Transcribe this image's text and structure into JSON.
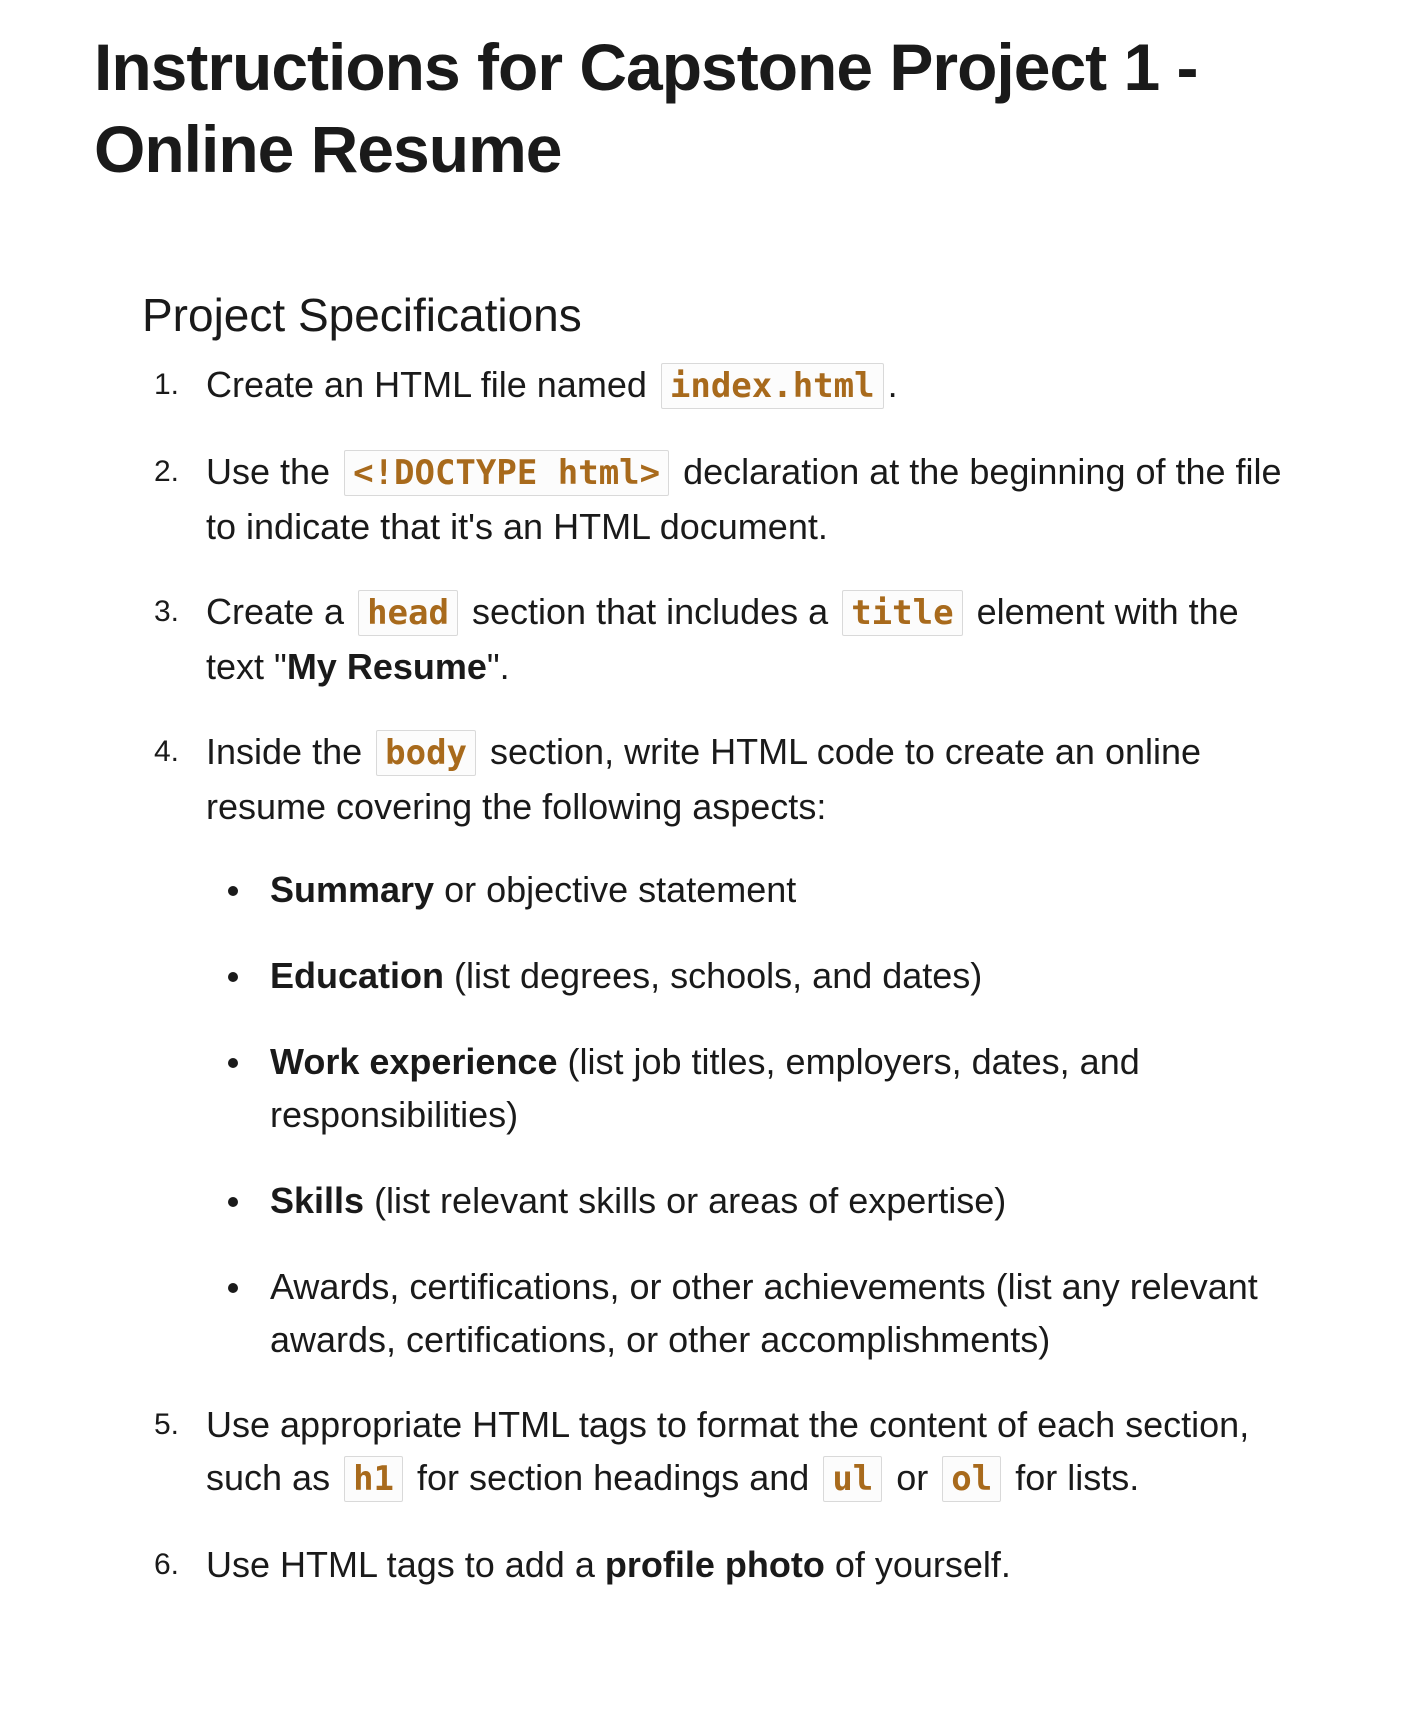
{
  "title": "Instructions for Capstone Project 1 - Online Resume",
  "section_heading": "Project Specifications",
  "steps": [
    {
      "number": "1.",
      "parts": [
        "Create an HTML file named ",
        "index.html",
        "."
      ]
    },
    {
      "number": "2.",
      "parts": [
        "Use the ",
        "<!DOCTYPE html>",
        " declaration at the beginning of the file to indicate that it's an HTML document."
      ]
    },
    {
      "number": "3.",
      "parts": [
        "Create a ",
        "head",
        " section that includes a ",
        "title",
        " element with the text \"",
        "My Resume",
        "\"."
      ]
    },
    {
      "number": "4.",
      "parts": [
        "Inside the ",
        "body",
        " section, write HTML code to create an online resume covering the following aspects:"
      ],
      "aspects": [
        {
          "bold": "Summary",
          "text": " or objective statement"
        },
        {
          "bold": "Education",
          "text": " (list degrees, schools, and dates)"
        },
        {
          "bold": "Work experience",
          "text": " (list job titles, employers, dates, and responsibilities)"
        },
        {
          "bold": "Skills",
          "text": " (list relevant skills or areas of expertise)"
        },
        {
          "bold": "",
          "text": "Awards, certifications, or other achievements (list any relevant awards, certifications, or other accomplishments)"
        }
      ]
    },
    {
      "number": "5.",
      "parts": [
        "Use appropriate HTML tags to format the content of each section, such as ",
        "h1",
        " for section headings and ",
        "ul",
        " or ",
        "ol",
        " for lists."
      ]
    },
    {
      "number": "6.",
      "parts": [
        "Use HTML tags to add a ",
        "profile photo",
        " of yourself."
      ]
    }
  ],
  "colors": {
    "text": "#1a1a1a",
    "code_text": "#a86a1c",
    "code_border": "#d9d9d9"
  }
}
